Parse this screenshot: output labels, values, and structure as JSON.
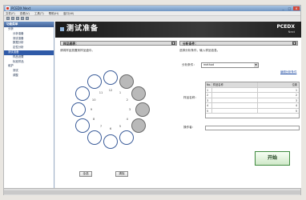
{
  "window": {
    "title": "PCEDX Next",
    "min": "_",
    "max": "□",
    "close": "×"
  },
  "menubar": [
    "文件(F)",
    "查看(V)",
    "工具(T)",
    "帮助(H)",
    "窗口(W)"
  ],
  "sidebar": {
    "header": "功能菜单",
    "items": [
      {
        "label": "分析",
        "sub": false,
        "selected": false
      },
      {
        "label": "分析准备",
        "sub": true,
        "selected": false
      },
      {
        "label": "测试准备",
        "sub": true,
        "selected": false
      },
      {
        "label": "数据分析",
        "sub": true,
        "selected": false
      },
      {
        "label": "定性分析",
        "sub": true,
        "selected": false
      },
      {
        "label": "测试准备",
        "sub": false,
        "selected": true
      },
      {
        "label": "样品设置",
        "sub": true,
        "selected": false
      },
      {
        "label": "标准样品",
        "sub": true,
        "selected": false
      },
      {
        "label": "维护",
        "sub": false,
        "selected": false
      },
      {
        "label": "测试",
        "sub": true,
        "selected": false
      },
      {
        "label": "调整",
        "sub": true,
        "selected": false
      }
    ]
  },
  "content": {
    "heading": "测试准备",
    "brand": "PCEDX",
    "brand_sub": "Next"
  },
  "left_panel": {
    "title": "样品图表：",
    "arrow": "▼",
    "instruction": "请将样品放置到样品盘中。",
    "positions": [
      "1",
      "2",
      "3",
      "4",
      "5",
      "6",
      "7",
      "8",
      "9",
      "10",
      "11",
      "12"
    ],
    "filled": [
      1,
      2,
      3,
      4
    ],
    "select_all": "全选",
    "clear": "清除"
  },
  "right_panel": {
    "title": "分析条件：",
    "arrow": "▼",
    "instruction": "选择分析条件，输入样品信息。",
    "method_label": "分析条件：",
    "method_value": "method",
    "link": "编辑分析条件",
    "sample_label": "样品名称：",
    "columns": [
      "No.",
      "样品名称",
      "位置"
    ],
    "rows": [
      {
        "no": "1",
        "name": "",
        "pos": "1"
      },
      {
        "no": "2",
        "name": "",
        "pos": "2"
      },
      {
        "no": "3",
        "name": "",
        "pos": "3"
      },
      {
        "no": "4",
        "name": "",
        "pos": "4"
      },
      {
        "no": "5",
        "name": "",
        "pos": "5"
      }
    ],
    "operator_label": "操作者：",
    "start": "开始"
  }
}
